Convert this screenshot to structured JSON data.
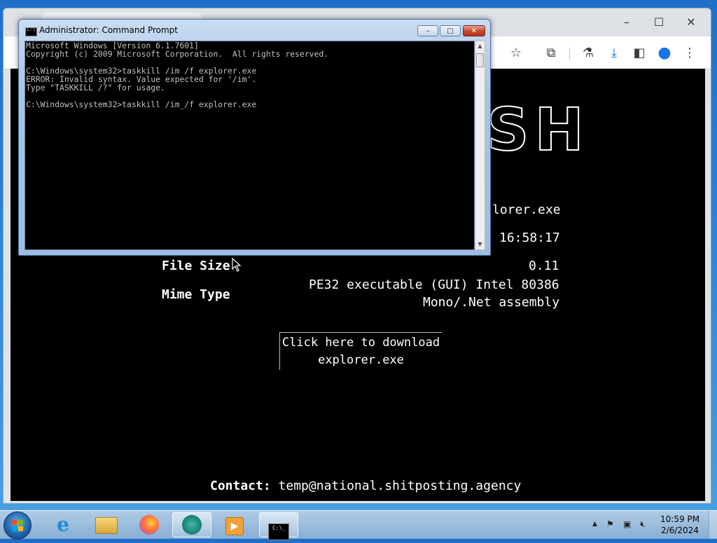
{
  "browser": {
    "webpage": {
      "ascii_title_fragment": "SH",
      "rows": [
        {
          "value": "lorer.exe"
        },
        {
          "value": "16:58:17"
        },
        {
          "label": "File Size",
          "value": "0.11"
        },
        {
          "label": "Mime Type",
          "value": "PE32 executable (GUI) Intel 80386"
        },
        {
          "value": "Mono/.Net assembly"
        }
      ],
      "download_line1": "Click here to download",
      "download_line2": "explorer.exe",
      "contact_label": "Contact:",
      "contact_value": "temp@national.shitposting.agency"
    }
  },
  "cmd": {
    "title": "Administrator: Command Prompt",
    "lines": [
      "Microsoft Windows [Version 6.1.7601]",
      "Copyright (c) 2009 Microsoft Corporation.  All rights reserved.",
      "",
      "C:\\Windows\\system32>taskkill /im /f explorer.exe",
      "ERROR: Invalid syntax. Value expected for '/im'.",
      "Type \"TASKKILL /?\" for usage.",
      "",
      "C:\\Windows\\system32>taskkill /im_/f explorer.exe"
    ],
    "buttons": {
      "minimize": "–",
      "maximize": "□",
      "close": "✕"
    }
  },
  "taskbar": {
    "time": "10:59 PM",
    "date": "2/6/2024",
    "apps": [
      "internet-explorer",
      "file-explorer",
      "firefox",
      "chrome",
      "media-player",
      "command-prompt"
    ]
  }
}
